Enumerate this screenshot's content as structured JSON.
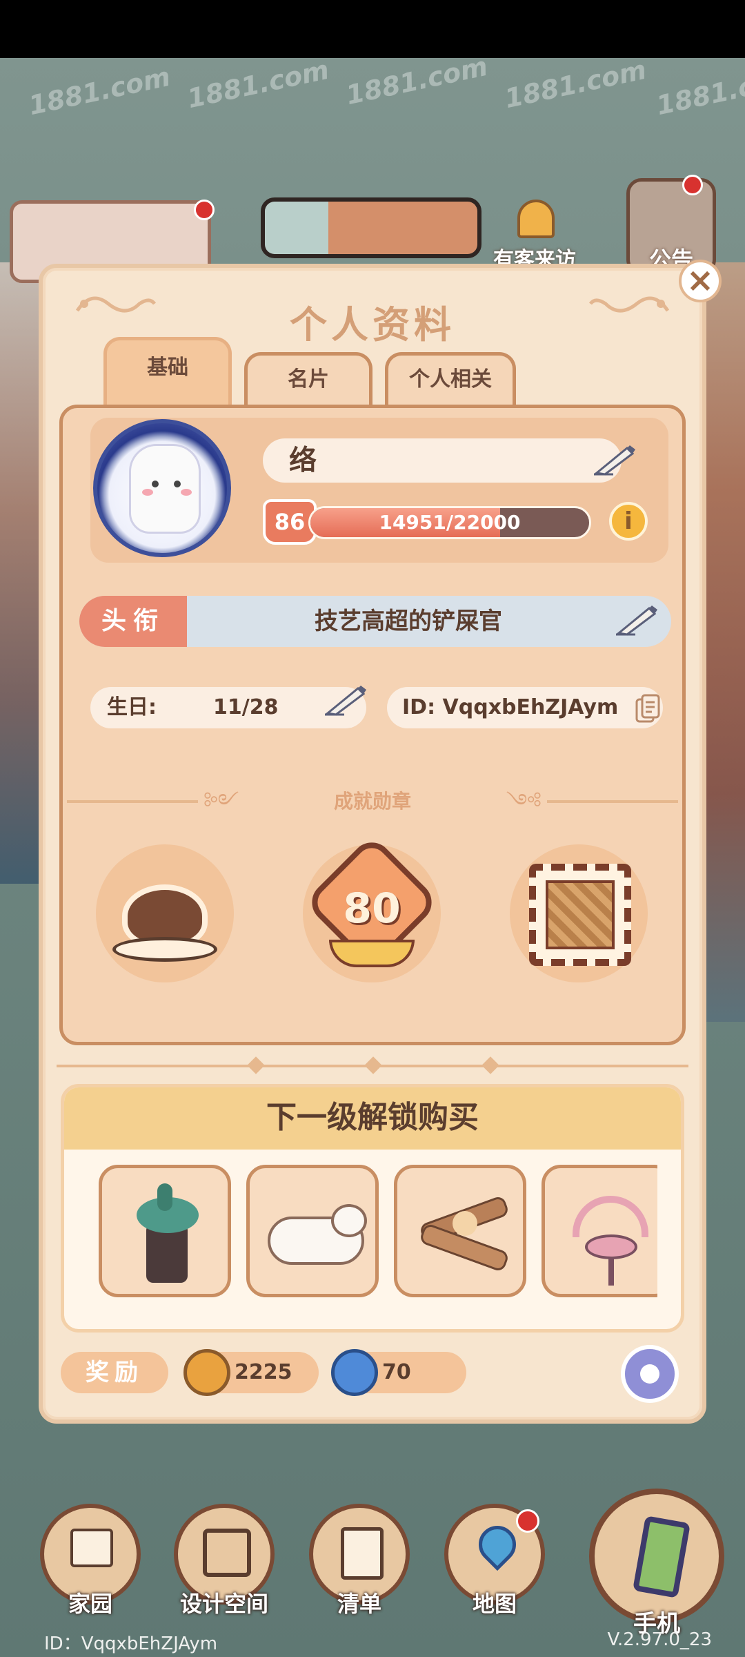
{
  "panel": {
    "title": "个人资料",
    "tabs": [
      "基础",
      "名片",
      "个人相关"
    ]
  },
  "profile": {
    "name": "络",
    "level": "86",
    "xp_text": "14951/22000",
    "xp_progress": 0.68,
    "title_label": "头衔",
    "title_value": "技艺高超的铲屎官",
    "birthday_label": "生日:",
    "birthday_value": "11/28",
    "id_label": "ID: VqqxbEhZJAym"
  },
  "achievements": {
    "section_label": "成就勋章",
    "badges": [
      {
        "name": "coffee-badge"
      },
      {
        "name": "level-80-badge",
        "number": "80"
      },
      {
        "name": "stamp-badge"
      }
    ]
  },
  "unlock": {
    "heading": "下一级解锁购买",
    "items": [
      {
        "icon": "plant-vase-icon"
      },
      {
        "icon": "sleeping-cat-icon"
      },
      {
        "icon": "woodpile-icon"
      },
      {
        "icon": "pink-chair-icon"
      }
    ]
  },
  "rewards": {
    "label": "奖励",
    "coins": "2225",
    "gems": "70"
  },
  "hud": {
    "visitor_text": "有客来访",
    "notice_text": "公告"
  },
  "nav": {
    "home": "家园",
    "design": "设计空间",
    "list": "清单",
    "map": "地图",
    "phone": "手机"
  },
  "footer": {
    "id": "ID：VqqxbEhZJAym",
    "version": "V.2.97.0_23"
  },
  "watermark": "1881.com",
  "colors": {
    "panel_bg": "#f7e5cf",
    "accent_orange": "#ea8a72",
    "title_color": "#d49f77",
    "border_brown": "#c98e62"
  }
}
